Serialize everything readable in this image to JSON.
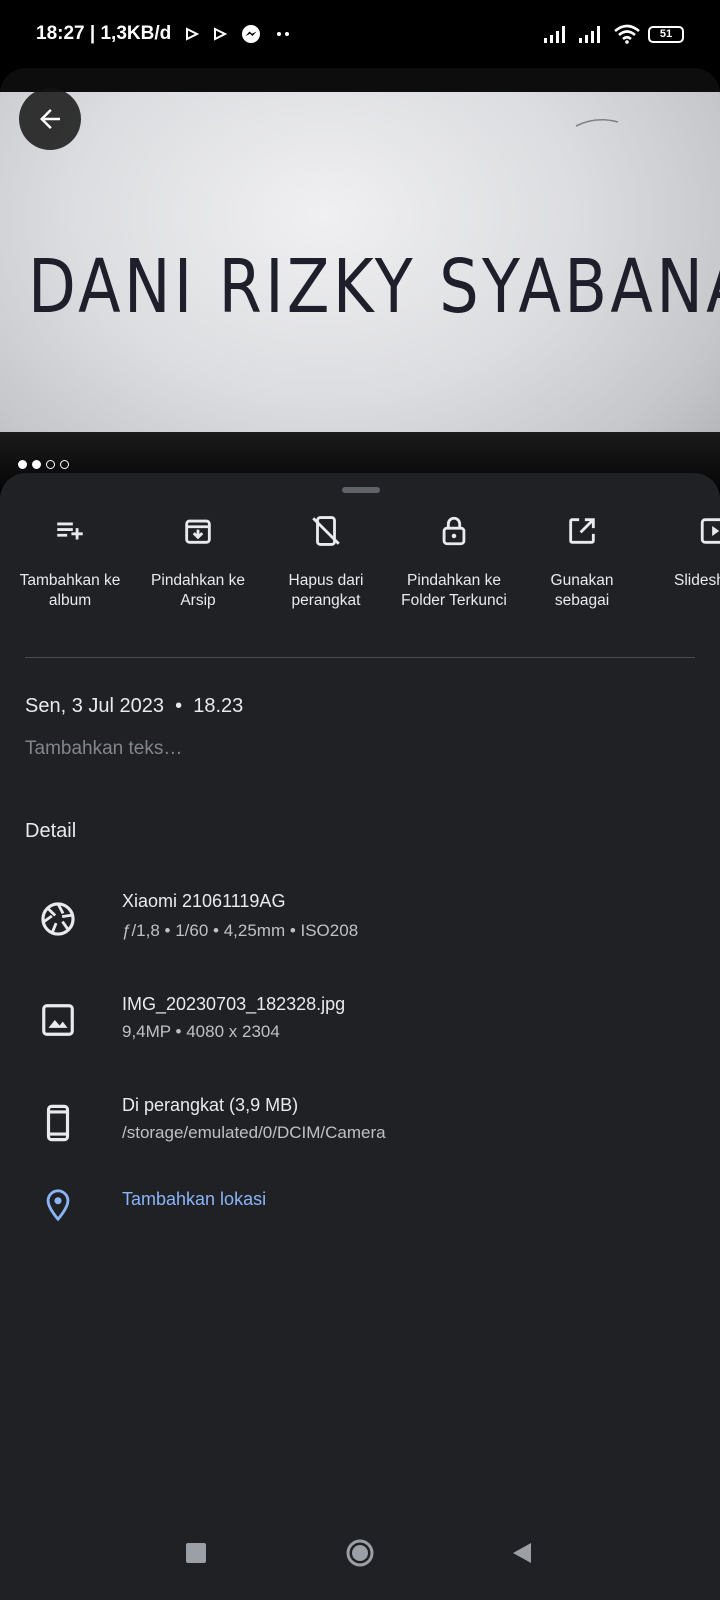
{
  "status": {
    "time_speed": "18:27 | 1,3KB/d",
    "battery": "51"
  },
  "photo": {
    "text": "DANI RIZKY SYABANA",
    "page_count": 4,
    "active_page": 2
  },
  "actions": [
    {
      "label": "Tambahkan ke\nalbum",
      "icon": "playlist-add-icon"
    },
    {
      "label": "Pindahkan ke\nArsip",
      "icon": "archive-icon"
    },
    {
      "label": "Hapus dari\nperangkat",
      "icon": "phone-off-icon"
    },
    {
      "label": "Pindahkan ke\nFolder Terkunci",
      "icon": "lock-icon"
    },
    {
      "label": "Gunakan\nsebagai",
      "icon": "open-external-icon"
    },
    {
      "label": "Slidesh",
      "icon": "slideshow-icon"
    }
  ],
  "info": {
    "date": "Sen, 3 Jul 2023  •  18.23",
    "caption_placeholder": "Tambahkan teks…",
    "detail_heading": "Detail"
  },
  "details": {
    "camera": {
      "title": "Xiaomi 21061119AG",
      "sub": "ƒ/1,8  •  1/60  •  4,25mm  •  ISO208"
    },
    "file": {
      "title": "IMG_20230703_182328.jpg",
      "sub": "9,4MP  •  4080 x 2304"
    },
    "storage": {
      "title": "Di perangkat (3,9 MB)",
      "sub": "/storage/emulated/0/DCIM/Camera"
    },
    "location": {
      "title": "Tambahkan lokasi"
    }
  },
  "colors": {
    "accent_link": "#8ab4f8",
    "sheet_bg": "#202124"
  }
}
